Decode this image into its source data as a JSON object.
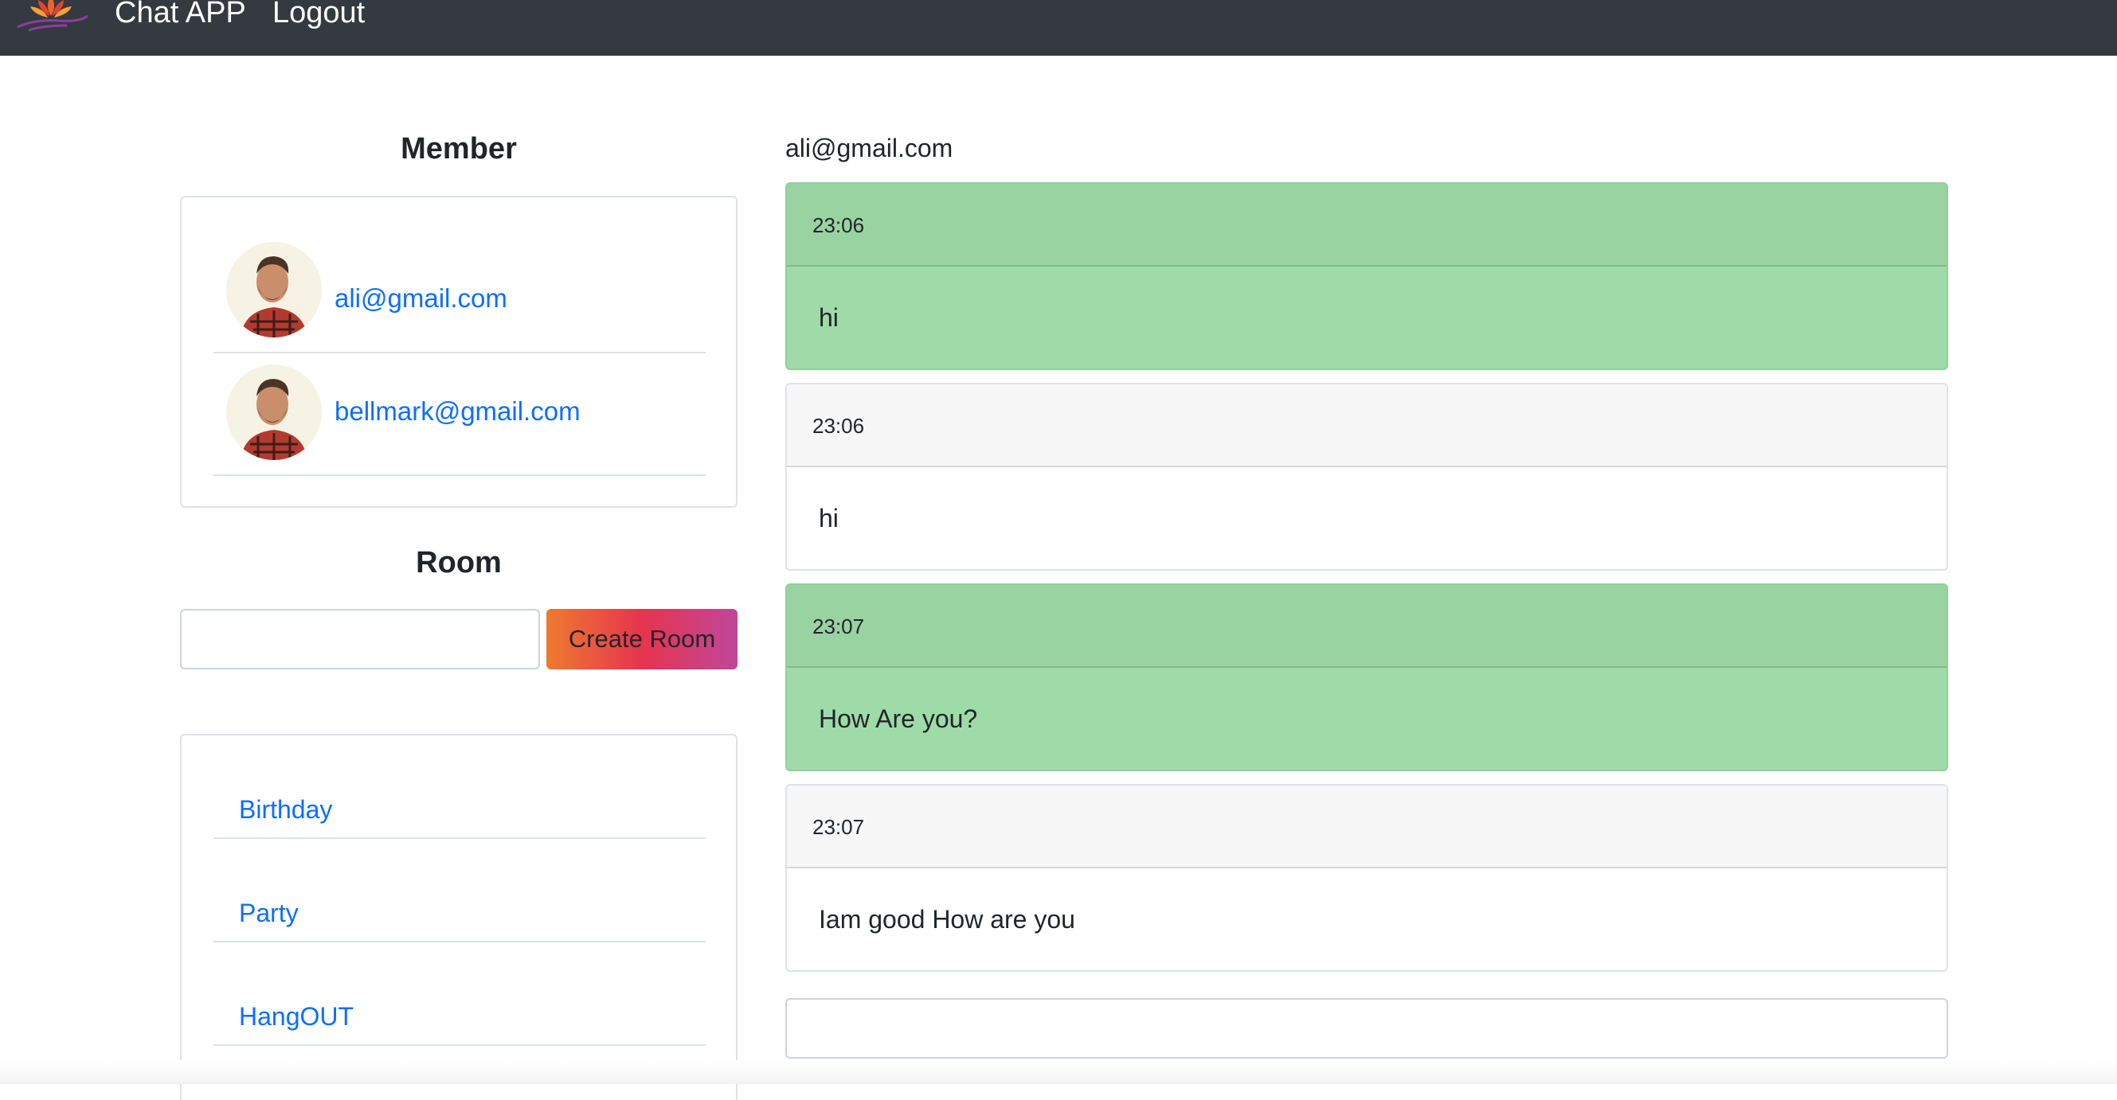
{
  "navbar": {
    "brand": "Chat APP",
    "logout": "Logout",
    "logo_icon": "lotus-logo-icon",
    "background": "#343a40"
  },
  "members": {
    "heading": "Member",
    "items": [
      {
        "email": "ali@gmail.com",
        "avatar_icon": "user-avatar-icon"
      },
      {
        "email": "bellmark@gmail.com",
        "avatar_icon": "user-avatar-icon"
      }
    ]
  },
  "rooms": {
    "heading": "Room",
    "input_value": "",
    "create_button": "Create Room",
    "items": [
      "Birthday",
      "Party",
      "HangOUT"
    ]
  },
  "chat": {
    "current_user": "ali@gmail.com",
    "messages": [
      {
        "time": "23:06",
        "text": "hi",
        "mine": true
      },
      {
        "time": "23:06",
        "text": "hi",
        "mine": false
      },
      {
        "time": "23:07",
        "text": "How Are you?",
        "mine": true
      },
      {
        "time": "23:07",
        "text": "Iam good How are you",
        "mine": false
      }
    ],
    "input_value": "",
    "mine_color": "#9fdba8",
    "link_color": "#0d6efd"
  }
}
